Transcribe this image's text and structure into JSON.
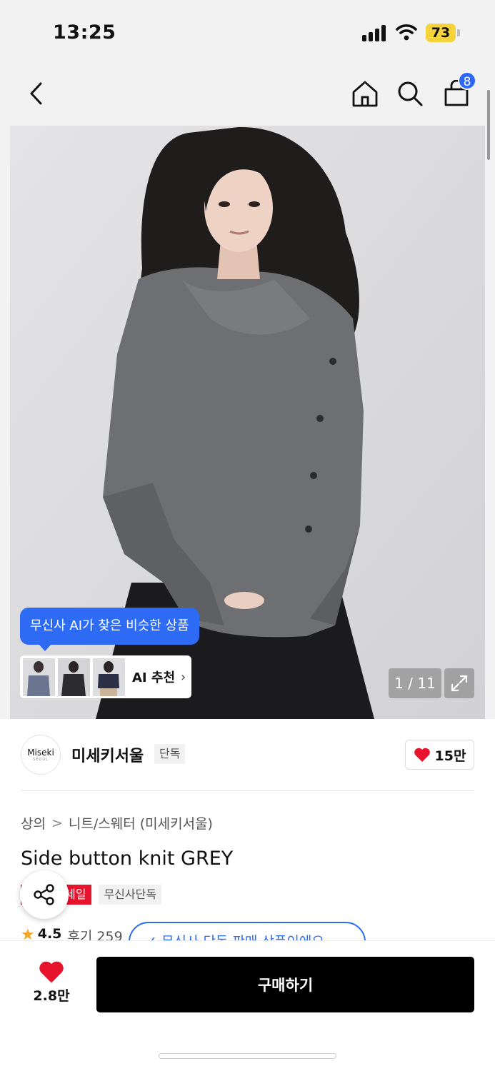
{
  "status_bar": {
    "time": "13:25",
    "battery": "73"
  },
  "nav": {
    "back_icon": "chevron-left-icon",
    "home_icon": "home-icon",
    "search_icon": "search-icon",
    "cart_icon": "shopping-bag-icon",
    "cart_count": "8"
  },
  "gallery": {
    "ai_tooltip": "무신사 AI가 찾은 비슷한 상품",
    "ai_reco_label": "AI 추천",
    "pager": "1 / 11"
  },
  "brand": {
    "logo_text": "Miseki",
    "logo_subtext": "SEOUL",
    "name": "미세키서울",
    "tag": "단독",
    "like_count": "15만"
  },
  "product": {
    "breadcrumb": [
      "상의",
      "니트/스웨터 (미세키서울)"
    ],
    "title": "Side button knit GREY",
    "badge_sale": "세일",
    "badge_exclusive": "무신사단독",
    "rating": "4.5",
    "review": "후기 259",
    "exclusive_notice": "✓ 무신사 단독 판매 상품이에요"
  },
  "bottom": {
    "wish_count": "2.8만",
    "buy_label": "구매하기"
  },
  "colors": {
    "accent_blue": "#2e6bf5",
    "sale_red": "#e8132c",
    "heart_red": "#e8132c",
    "buy_button": "#000000"
  }
}
